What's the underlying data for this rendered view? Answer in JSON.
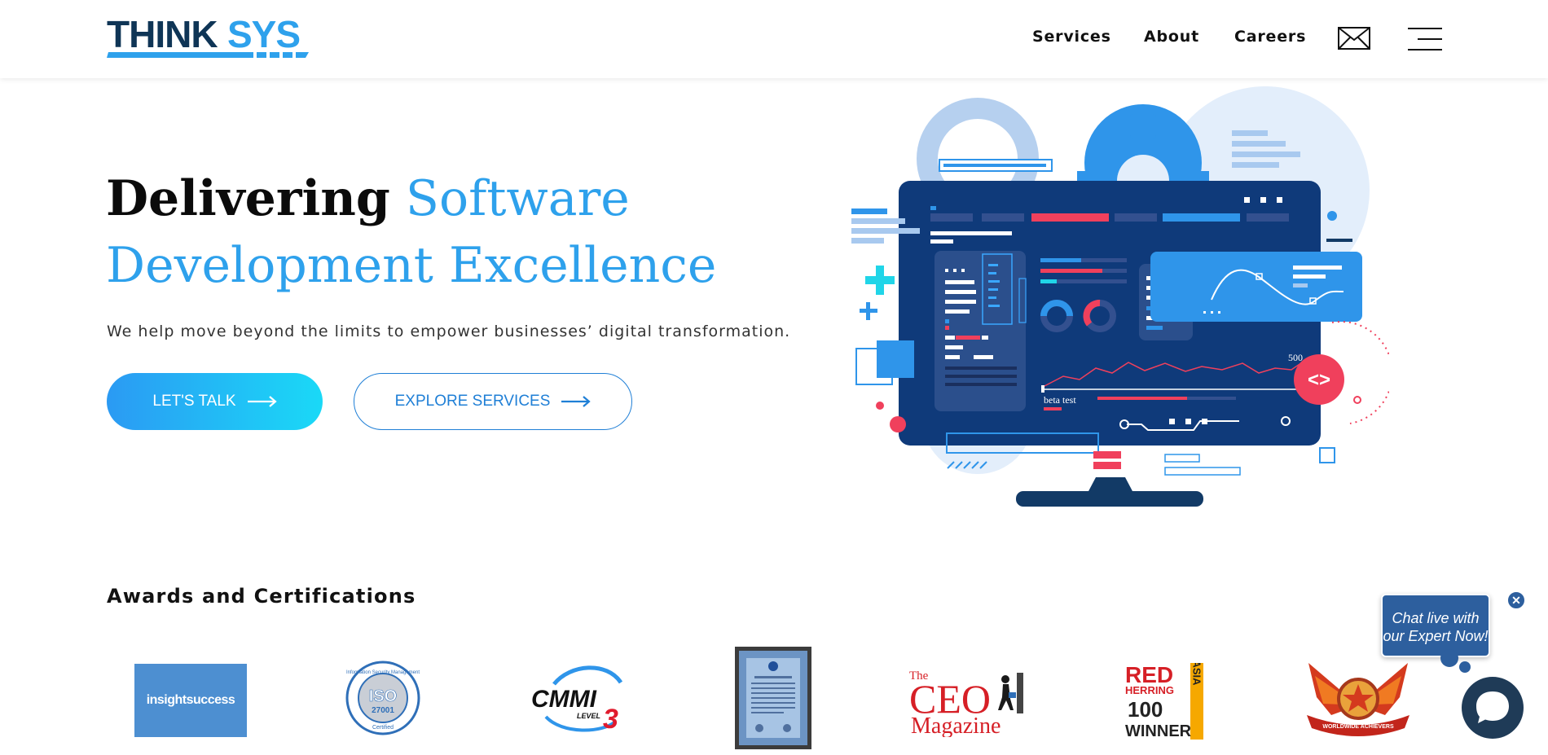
{
  "brand": {
    "logo_text_dark": "THINK",
    "logo_text_blue": "SYS",
    "colors": {
      "navy": "#0f3556",
      "blue": "#2ea1ec",
      "accent_red": "#f0405c"
    }
  },
  "nav": {
    "services": "Services",
    "about": "About",
    "careers": "Careers",
    "mail_icon": "mail-icon",
    "menu_icon": "hamburger-icon"
  },
  "hero": {
    "title_dark": "Delivering",
    "title_blue_1": "Software",
    "title_blue_2": "Development Excellence",
    "subtitle": "We help move beyond the limits to empower businesses’ digital transformation.",
    "cta_primary": "LET'S TALK",
    "cta_secondary": "EXPLORE SERVICES",
    "illustration": {
      "chart_label": "beta test",
      "chart_value": "500",
      "code_badge": "<>"
    }
  },
  "awards": {
    "heading": "Awards and Certifications",
    "insights": "insightsuccess",
    "iso_top": "Information Security Management",
    "iso_main": "ISO",
    "iso_number": "27001",
    "iso_bottom": "Certified",
    "cmmi": "CMMI",
    "cmmi_level": "LEVEL",
    "cmmi_num": "3",
    "ceo_the": "The",
    "ceo_main": "CEO",
    "ceo_magazine": "Magazine",
    "red_herring_red": "RED",
    "red_herring_herring": "HERRING",
    "red_herring_asia": "ASIA",
    "red_herring_100": "100",
    "red_herring_winner": "WINNER",
    "achievers": "WORLDWIDE ACHIEVERS"
  },
  "chat": {
    "bubble": "Chat live with our Expert Now!",
    "close": "✕"
  }
}
